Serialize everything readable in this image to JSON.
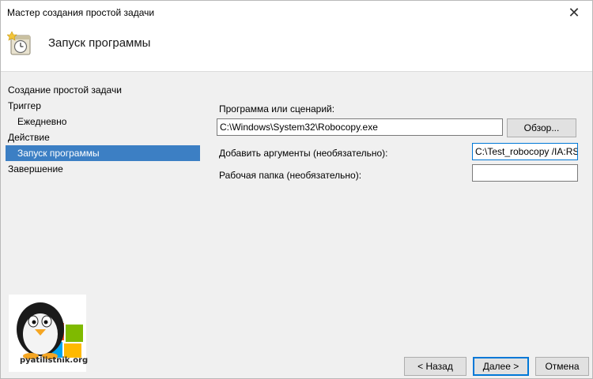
{
  "window": {
    "title": "Мастер создания простой задачи",
    "close_glyph": "✕",
    "header_title": "Запуск программы",
    "header_icon": "task-clock-icon"
  },
  "sidebar": {
    "items": [
      {
        "label": "Создание простой задачи",
        "level": 0,
        "selected": false
      },
      {
        "label": "Триггер",
        "level": 0,
        "selected": false
      },
      {
        "label": "Ежедневно",
        "level": 1,
        "selected": false
      },
      {
        "label": "Действие",
        "level": 0,
        "selected": false
      },
      {
        "label": "Запуск программы",
        "level": 1,
        "selected": true
      },
      {
        "label": "Завершение",
        "level": 0,
        "selected": false
      }
    ]
  },
  "form": {
    "program_label": "Программа или сценарий:",
    "program_value": "C:\\Windows\\System32\\Robocopy.exe",
    "browse_label": "Обзор...",
    "args_label": "Добавить аргументы (необязательно):",
    "args_value": "C:\\Test_robocopy /IA:RS",
    "workdir_label": "Рабочая папка (необязательно):",
    "workdir_value": ""
  },
  "logo": {
    "text": "pyatilistnik.org"
  },
  "footer": {
    "back_label": "< Назад",
    "next_label": "Далее >",
    "cancel_label": "Отмена"
  },
  "colors": {
    "selection": "#3c7fc4",
    "focus_border": "#0078d7",
    "button_face": "#e1e1e1"
  }
}
